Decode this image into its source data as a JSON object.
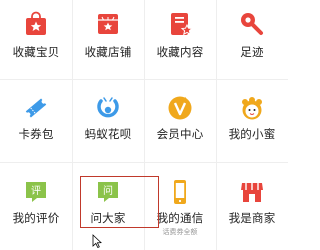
{
  "grid": {
    "items": [
      {
        "label": "收藏宝贝",
        "icon": "shopping-bag-star-icon",
        "color": "#e8453c"
      },
      {
        "label": "收藏店铺",
        "icon": "store-star-icon",
        "color": "#e8453c"
      },
      {
        "label": "收藏内容",
        "icon": "document-star-icon",
        "color": "#e8453c"
      },
      {
        "label": "足迹",
        "icon": "footprint-pin-icon",
        "color": "#e8453c"
      },
      {
        "label": "卡券包",
        "icon": "ticket-icon",
        "color": "#3d9ae8"
      },
      {
        "label": "蚂蚁花呗",
        "icon": "ant-huabei-icon",
        "color": "#3d9ae8"
      },
      {
        "label": "会员中心",
        "icon": "vip-v-icon",
        "color": "#f0a81c"
      },
      {
        "label": "我的小蜜",
        "icon": "assistant-face-icon",
        "color": "#f0a81c"
      },
      {
        "label": "我的评价",
        "icon": "review-chat-icon",
        "color": "#8bc34a"
      },
      {
        "label": "问大家",
        "icon": "question-chat-icon",
        "color": "#8bc34a"
      },
      {
        "label": "我的通信",
        "icon": "phone-icon",
        "color": "#f0a81c",
        "sublabel": "话费券全额"
      },
      {
        "label": "我是商家",
        "icon": "merchant-store-icon",
        "color": "#e8453c"
      }
    ]
  },
  "colors": {
    "highlight": "#c0392b",
    "text": "#222222",
    "divider": "#eeeeee"
  }
}
